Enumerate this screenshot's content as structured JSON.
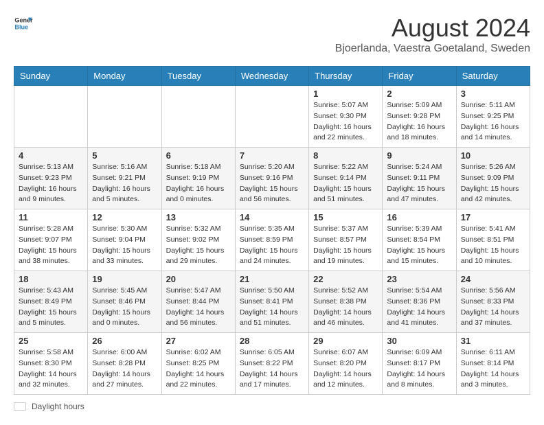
{
  "header": {
    "logo_general": "General",
    "logo_blue": "Blue",
    "main_title": "August 2024",
    "subtitle": "Bjoerlanda, Vaestra Goetaland, Sweden"
  },
  "days_of_week": [
    "Sunday",
    "Monday",
    "Tuesday",
    "Wednesday",
    "Thursday",
    "Friday",
    "Saturday"
  ],
  "footer": {
    "label": "Daylight hours"
  },
  "weeks": [
    {
      "days": [
        {
          "num": "",
          "sunrise": "",
          "sunset": "",
          "daylight": ""
        },
        {
          "num": "",
          "sunrise": "",
          "sunset": "",
          "daylight": ""
        },
        {
          "num": "",
          "sunrise": "",
          "sunset": "",
          "daylight": ""
        },
        {
          "num": "",
          "sunrise": "",
          "sunset": "",
          "daylight": ""
        },
        {
          "num": "1",
          "sunrise": "Sunrise: 5:07 AM",
          "sunset": "Sunset: 9:30 PM",
          "daylight": "Daylight: 16 hours and 22 minutes."
        },
        {
          "num": "2",
          "sunrise": "Sunrise: 5:09 AM",
          "sunset": "Sunset: 9:28 PM",
          "daylight": "Daylight: 16 hours and 18 minutes."
        },
        {
          "num": "3",
          "sunrise": "Sunrise: 5:11 AM",
          "sunset": "Sunset: 9:25 PM",
          "daylight": "Daylight: 16 hours and 14 minutes."
        }
      ]
    },
    {
      "days": [
        {
          "num": "4",
          "sunrise": "Sunrise: 5:13 AM",
          "sunset": "Sunset: 9:23 PM",
          "daylight": "Daylight: 16 hours and 9 minutes."
        },
        {
          "num": "5",
          "sunrise": "Sunrise: 5:16 AM",
          "sunset": "Sunset: 9:21 PM",
          "daylight": "Daylight: 16 hours and 5 minutes."
        },
        {
          "num": "6",
          "sunrise": "Sunrise: 5:18 AM",
          "sunset": "Sunset: 9:19 PM",
          "daylight": "Daylight: 16 hours and 0 minutes."
        },
        {
          "num": "7",
          "sunrise": "Sunrise: 5:20 AM",
          "sunset": "Sunset: 9:16 PM",
          "daylight": "Daylight: 15 hours and 56 minutes."
        },
        {
          "num": "8",
          "sunrise": "Sunrise: 5:22 AM",
          "sunset": "Sunset: 9:14 PM",
          "daylight": "Daylight: 15 hours and 51 minutes."
        },
        {
          "num": "9",
          "sunrise": "Sunrise: 5:24 AM",
          "sunset": "Sunset: 9:11 PM",
          "daylight": "Daylight: 15 hours and 47 minutes."
        },
        {
          "num": "10",
          "sunrise": "Sunrise: 5:26 AM",
          "sunset": "Sunset: 9:09 PM",
          "daylight": "Daylight: 15 hours and 42 minutes."
        }
      ]
    },
    {
      "days": [
        {
          "num": "11",
          "sunrise": "Sunrise: 5:28 AM",
          "sunset": "Sunset: 9:07 PM",
          "daylight": "Daylight: 15 hours and 38 minutes."
        },
        {
          "num": "12",
          "sunrise": "Sunrise: 5:30 AM",
          "sunset": "Sunset: 9:04 PM",
          "daylight": "Daylight: 15 hours and 33 minutes."
        },
        {
          "num": "13",
          "sunrise": "Sunrise: 5:32 AM",
          "sunset": "Sunset: 9:02 PM",
          "daylight": "Daylight: 15 hours and 29 minutes."
        },
        {
          "num": "14",
          "sunrise": "Sunrise: 5:35 AM",
          "sunset": "Sunset: 8:59 PM",
          "daylight": "Daylight: 15 hours and 24 minutes."
        },
        {
          "num": "15",
          "sunrise": "Sunrise: 5:37 AM",
          "sunset": "Sunset: 8:57 PM",
          "daylight": "Daylight: 15 hours and 19 minutes."
        },
        {
          "num": "16",
          "sunrise": "Sunrise: 5:39 AM",
          "sunset": "Sunset: 8:54 PM",
          "daylight": "Daylight: 15 hours and 15 minutes."
        },
        {
          "num": "17",
          "sunrise": "Sunrise: 5:41 AM",
          "sunset": "Sunset: 8:51 PM",
          "daylight": "Daylight: 15 hours and 10 minutes."
        }
      ]
    },
    {
      "days": [
        {
          "num": "18",
          "sunrise": "Sunrise: 5:43 AM",
          "sunset": "Sunset: 8:49 PM",
          "daylight": "Daylight: 15 hours and 5 minutes."
        },
        {
          "num": "19",
          "sunrise": "Sunrise: 5:45 AM",
          "sunset": "Sunset: 8:46 PM",
          "daylight": "Daylight: 15 hours and 0 minutes."
        },
        {
          "num": "20",
          "sunrise": "Sunrise: 5:47 AM",
          "sunset": "Sunset: 8:44 PM",
          "daylight": "Daylight: 14 hours and 56 minutes."
        },
        {
          "num": "21",
          "sunrise": "Sunrise: 5:50 AM",
          "sunset": "Sunset: 8:41 PM",
          "daylight": "Daylight: 14 hours and 51 minutes."
        },
        {
          "num": "22",
          "sunrise": "Sunrise: 5:52 AM",
          "sunset": "Sunset: 8:38 PM",
          "daylight": "Daylight: 14 hours and 46 minutes."
        },
        {
          "num": "23",
          "sunrise": "Sunrise: 5:54 AM",
          "sunset": "Sunset: 8:36 PM",
          "daylight": "Daylight: 14 hours and 41 minutes."
        },
        {
          "num": "24",
          "sunrise": "Sunrise: 5:56 AM",
          "sunset": "Sunset: 8:33 PM",
          "daylight": "Daylight: 14 hours and 37 minutes."
        }
      ]
    },
    {
      "days": [
        {
          "num": "25",
          "sunrise": "Sunrise: 5:58 AM",
          "sunset": "Sunset: 8:30 PM",
          "daylight": "Daylight: 14 hours and 32 minutes."
        },
        {
          "num": "26",
          "sunrise": "Sunrise: 6:00 AM",
          "sunset": "Sunset: 8:28 PM",
          "daylight": "Daylight: 14 hours and 27 minutes."
        },
        {
          "num": "27",
          "sunrise": "Sunrise: 6:02 AM",
          "sunset": "Sunset: 8:25 PM",
          "daylight": "Daylight: 14 hours and 22 minutes."
        },
        {
          "num": "28",
          "sunrise": "Sunrise: 6:05 AM",
          "sunset": "Sunset: 8:22 PM",
          "daylight": "Daylight: 14 hours and 17 minutes."
        },
        {
          "num": "29",
          "sunrise": "Sunrise: 6:07 AM",
          "sunset": "Sunset: 8:20 PM",
          "daylight": "Daylight: 14 hours and 12 minutes."
        },
        {
          "num": "30",
          "sunrise": "Sunrise: 6:09 AM",
          "sunset": "Sunset: 8:17 PM",
          "daylight": "Daylight: 14 hours and 8 minutes."
        },
        {
          "num": "31",
          "sunrise": "Sunrise: 6:11 AM",
          "sunset": "Sunset: 8:14 PM",
          "daylight": "Daylight: 14 hours and 3 minutes."
        }
      ]
    }
  ]
}
